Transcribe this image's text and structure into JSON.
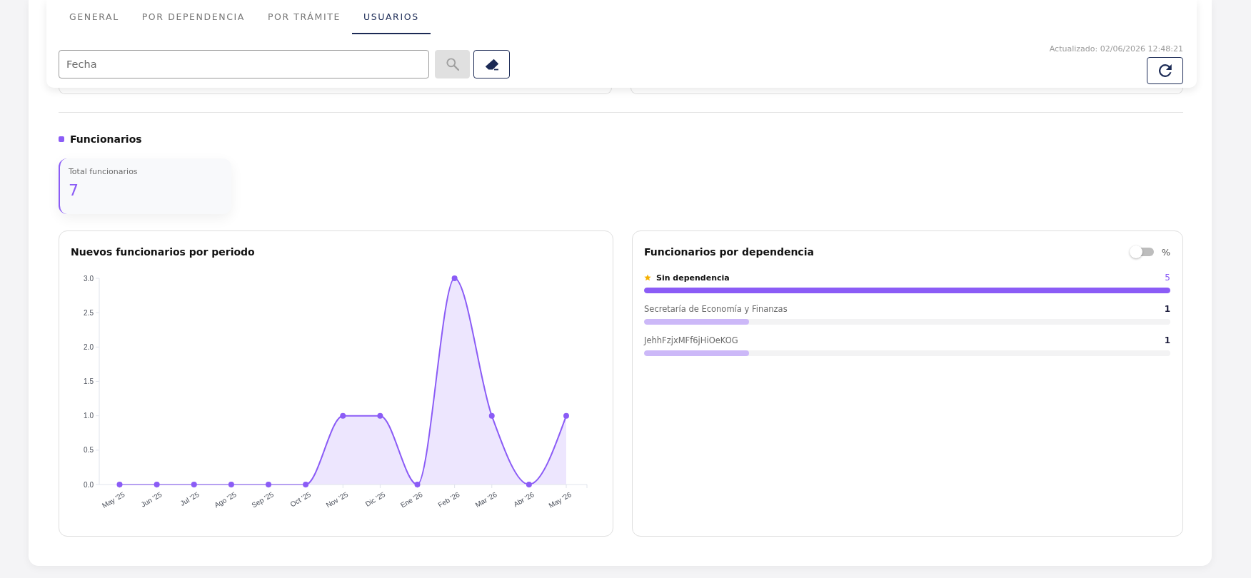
{
  "tabs": [
    {
      "label": "GENERAL",
      "selected": false
    },
    {
      "label": "POR DEPENDENCIA",
      "selected": false
    },
    {
      "label": "POR TRÁMITE",
      "selected": false
    },
    {
      "label": "USUARIOS",
      "selected": true
    }
  ],
  "filter": {
    "date_field": {
      "placeholder": "Fecha"
    },
    "search_button": {
      "disabled": true
    }
  },
  "updated": "Actualizado: 02/06/2026 12:48:21",
  "section": {
    "title": "Funcionarios"
  },
  "stat_card": {
    "label": "Total funcionarios",
    "value": "7"
  },
  "period_chart": {
    "title": "Nuevos funcionarios por periodo",
    "chart_data": {
      "type": "area",
      "categories": [
        "May '25",
        "Jun '25",
        "Jul '25",
        "Ago '25",
        "Sep '25",
        "Oct '25",
        "Nov '25",
        "Dic '25",
        "Ene '26",
        "Feb '26",
        "Mar '26",
        "Abr '26",
        "May '26"
      ],
      "series": [
        {
          "values": [
            0,
            0,
            0,
            0,
            0,
            0,
            1,
            1,
            0,
            3,
            1,
            0,
            1
          ]
        }
      ],
      "ylim": [
        0,
        3
      ],
      "yticks": [
        {
          "value": 0,
          "label": "0.0"
        },
        {
          "value": 0.5,
          "label": "0.5"
        },
        {
          "value": 1,
          "label": "1.0"
        },
        {
          "value": 1.5,
          "label": "1.5"
        },
        {
          "value": 2,
          "label": "2.0"
        },
        {
          "value": 2.5,
          "label": "2.5"
        },
        {
          "value": 3,
          "label": "3.0"
        }
      ]
    }
  },
  "dependency_panel": {
    "title": "Funcionarios por dependencia",
    "percent_toggle": {
      "label": "%",
      "on": false
    },
    "items": [
      {
        "name": "Sin dependencia",
        "value": "5",
        "level": 1,
        "highlighted": true
      },
      {
        "name": "Secretaría de Economía y Finanzas",
        "value": "1",
        "level": 0.2,
        "highlighted": false
      },
      {
        "name": "JehhFzjxMFf6jHiOeKOG",
        "value": "1",
        "level": 0.2,
        "highlighted": false
      }
    ]
  }
}
